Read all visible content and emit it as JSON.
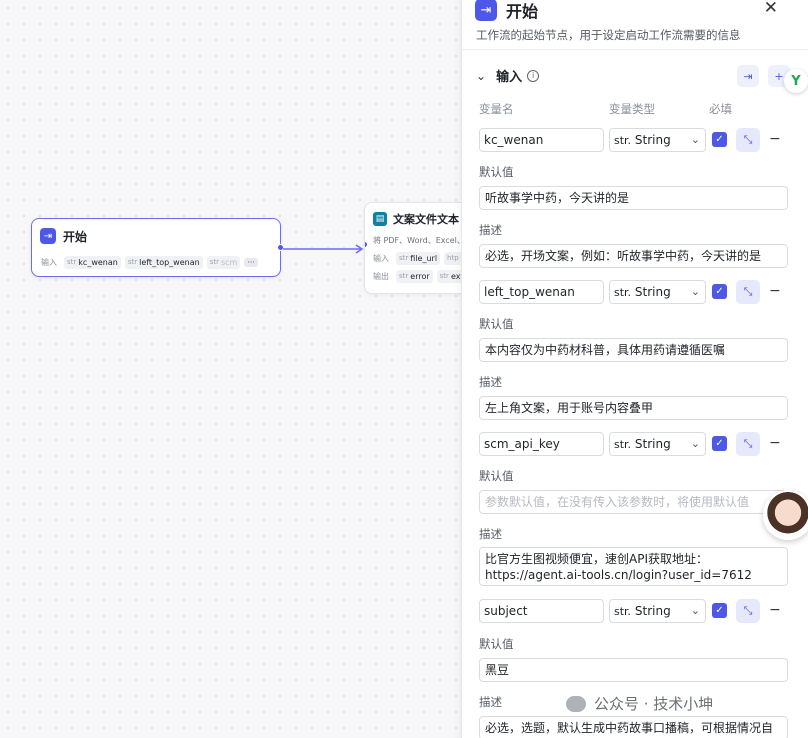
{
  "canvas": {
    "start_node": {
      "title": "开始",
      "input_label": "输入",
      "chips": [
        {
          "type": "str",
          "name": "kc_wenan"
        },
        {
          "type": "str",
          "name": "left_top_wenan"
        },
        {
          "type": "str",
          "name": "scm"
        }
      ],
      "more": "···"
    },
    "doc_node": {
      "title": "文案文件文本",
      "desc": "将 PDF、Word、Excel、",
      "input_label": "输入",
      "input_chips": [
        {
          "type": "str",
          "name": "file_url"
        },
        {
          "type": "htp",
          "name": ""
        }
      ],
      "output_label": "输出",
      "output_chips": [
        {
          "type": "str",
          "name": "error"
        },
        {
          "type": "str",
          "name": "ext"
        }
      ]
    }
  },
  "panel": {
    "title": "开始",
    "description": "工作流的起始节点，用于设定启动工作流需要的信息",
    "section_title": "输入",
    "columns": {
      "name": "变量名",
      "type": "变量类型",
      "required": "必填"
    },
    "default_label": "默认值",
    "desc_label": "描述",
    "variables": [
      {
        "name": "kc_wenan",
        "type_prefix": "str.",
        "type": "String",
        "default": "听故事学中药，今天讲的是",
        "default_is_placeholder": false,
        "description": "必选，开场文案，例如：听故事学中药，今天讲的是"
      },
      {
        "name": "left_top_wenan",
        "type_prefix": "str.",
        "type": "String",
        "default": "本内容仅为中药材科普，具体用药请遵循医嘱",
        "default_is_placeholder": false,
        "description": "左上角文案，用于账号内容叠甲"
      },
      {
        "name": "scm_api_key",
        "type_prefix": "str.",
        "type": "String",
        "default": "参数默认值，在没有传入该参数时，将使用默认值",
        "default_is_placeholder": true,
        "description": "比官方生图视频便宜，速创API获取地址：https://agent.ai-tools.cn/login?user_id=7612"
      },
      {
        "name": "subject",
        "type_prefix": "str.",
        "type": "String",
        "default": "黑豆",
        "default_is_placeholder": false,
        "description": "必选，选题，默认生成中药故事口播稿，可根据情况自"
      }
    ]
  },
  "watermark": "公众号 · 技术小坤",
  "colors": {
    "accent": "#4e58e8",
    "edge": "#6a6cf6"
  }
}
